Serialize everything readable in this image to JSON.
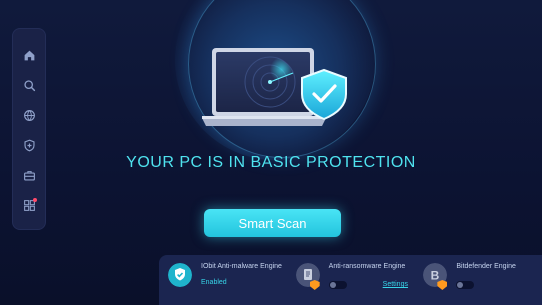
{
  "headline": "YOUR PC IS IN BASIC PROTECTION",
  "scan_button": "Smart Scan",
  "sidebar": {
    "items": [
      {
        "name": "home-icon",
        "active": true
      },
      {
        "name": "search-icon"
      },
      {
        "name": "globe-icon"
      },
      {
        "name": "shield-plus-icon"
      },
      {
        "name": "toolbox-icon"
      },
      {
        "name": "apps-icon",
        "badge": true
      }
    ]
  },
  "engines": [
    {
      "name": "IObit Anti-malware Engine",
      "status": "Enabled",
      "icon": "shield-check-icon"
    },
    {
      "name": "Anti-ransomware Engine",
      "link": "Settings",
      "icon": "document-lock-icon"
    },
    {
      "name": "Bitdefender Engine",
      "icon": "bitdefender-b-icon"
    }
  ],
  "colors": {
    "accent": "#37d5e8",
    "background": "#0e1430",
    "panel": "#1b2550",
    "warning": "#ff9a1f"
  }
}
